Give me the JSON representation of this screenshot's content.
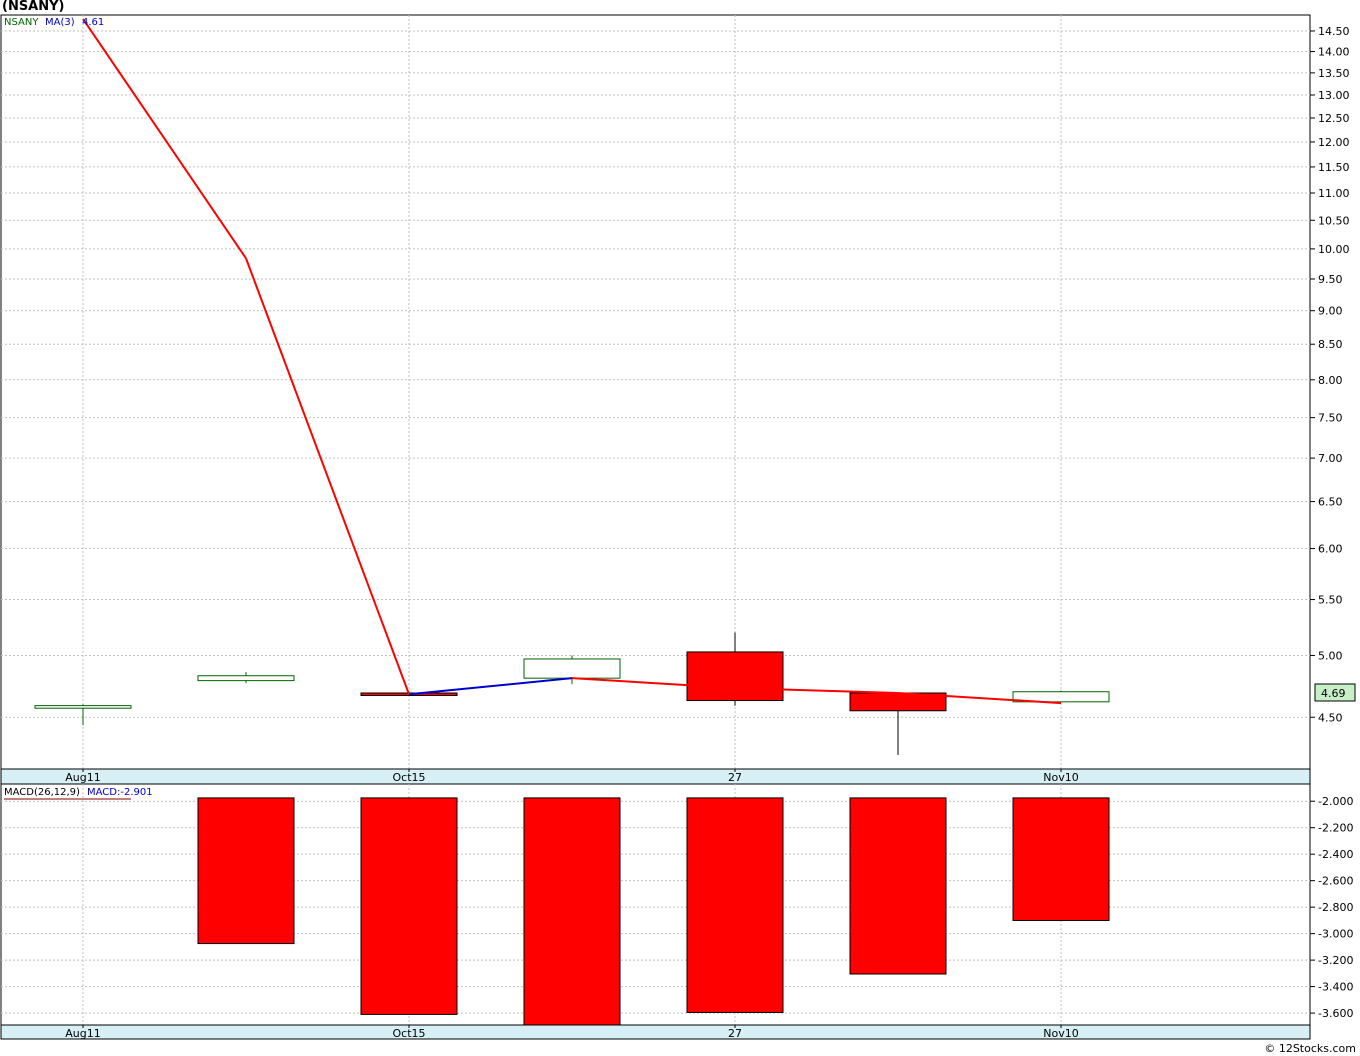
{
  "title": "(NSANY)",
  "credit": "© 12Stocks.com",
  "colors": {
    "up": "#006400",
    "down": "#ff0000",
    "ma_line": "#ff0000",
    "ma_up": "#0000cc",
    "grid": "#c0c0c0",
    "axis_strip": "#d6f0f5",
    "last_price_bg": "#c8f0c8"
  },
  "chart_data": [
    {
      "type": "candlestick",
      "name": "price",
      "legend": {
        "symbol": "NSANY",
        "ma_label": "MA(3)",
        "ma_value": "4.61"
      },
      "ylim": [
        4.12,
        14.9
      ],
      "y_ticks": [
        "4.50",
        "5.00",
        "5.50",
        "6.00",
        "6.50",
        "7.00",
        "7.50",
        "8.00",
        "8.50",
        "9.00",
        "9.50",
        "10.00",
        "10.50",
        "11.00",
        "11.50",
        "12.00",
        "12.50",
        "13.00",
        "13.50",
        "14.00",
        "14.50"
      ],
      "x_labels": [
        "Aug11",
        "Oct15",
        "27",
        "Nov10"
      ],
      "x_label_positions": [
        0,
        2,
        4,
        6
      ],
      "last_price": "4.69",
      "candles": [
        {
          "open": 4.57,
          "close": 4.59,
          "high": 4.6,
          "low": 4.44
        },
        {
          "open": 4.79,
          "close": 4.83,
          "high": 4.86,
          "low": 4.77
        },
        {
          "open": 4.69,
          "close": 4.67,
          "high": 4.69,
          "low": 4.67
        },
        {
          "open": 4.81,
          "close": 4.97,
          "high": 5.0,
          "low": 4.76
        },
        {
          "open": 5.03,
          "close": 4.63,
          "high": 5.2,
          "low": 4.59
        },
        {
          "open": 4.69,
          "close": 4.55,
          "high": 4.69,
          "low": 4.22
        },
        {
          "open": 4.62,
          "close": 4.7,
          "high": 4.71,
          "low": 4.62
        }
      ],
      "ma": [
        14.8,
        9.84,
        4.68,
        4.81,
        4.73,
        4.69,
        4.61
      ]
    },
    {
      "type": "bar",
      "name": "macd",
      "legend": {
        "label": "MACD(26,12,9)",
        "value_label": "MACD:-2.901"
      },
      "ylim": [
        -3.69,
        -1.87
      ],
      "y_ticks": [
        "-2.000",
        "-2.200",
        "-2.400",
        "-2.600",
        "-2.800",
        "-3.000",
        "-3.200",
        "-3.400",
        "-3.600"
      ],
      "x_labels": [
        "Aug11",
        "Oct15",
        "27",
        "Nov10"
      ],
      "x_label_positions": [
        0,
        2,
        4,
        6
      ],
      "bar_base": -1.975,
      "values": [
        null,
        -3.075,
        -3.61,
        -3.69,
        -3.595,
        -3.305,
        -2.901
      ]
    }
  ]
}
